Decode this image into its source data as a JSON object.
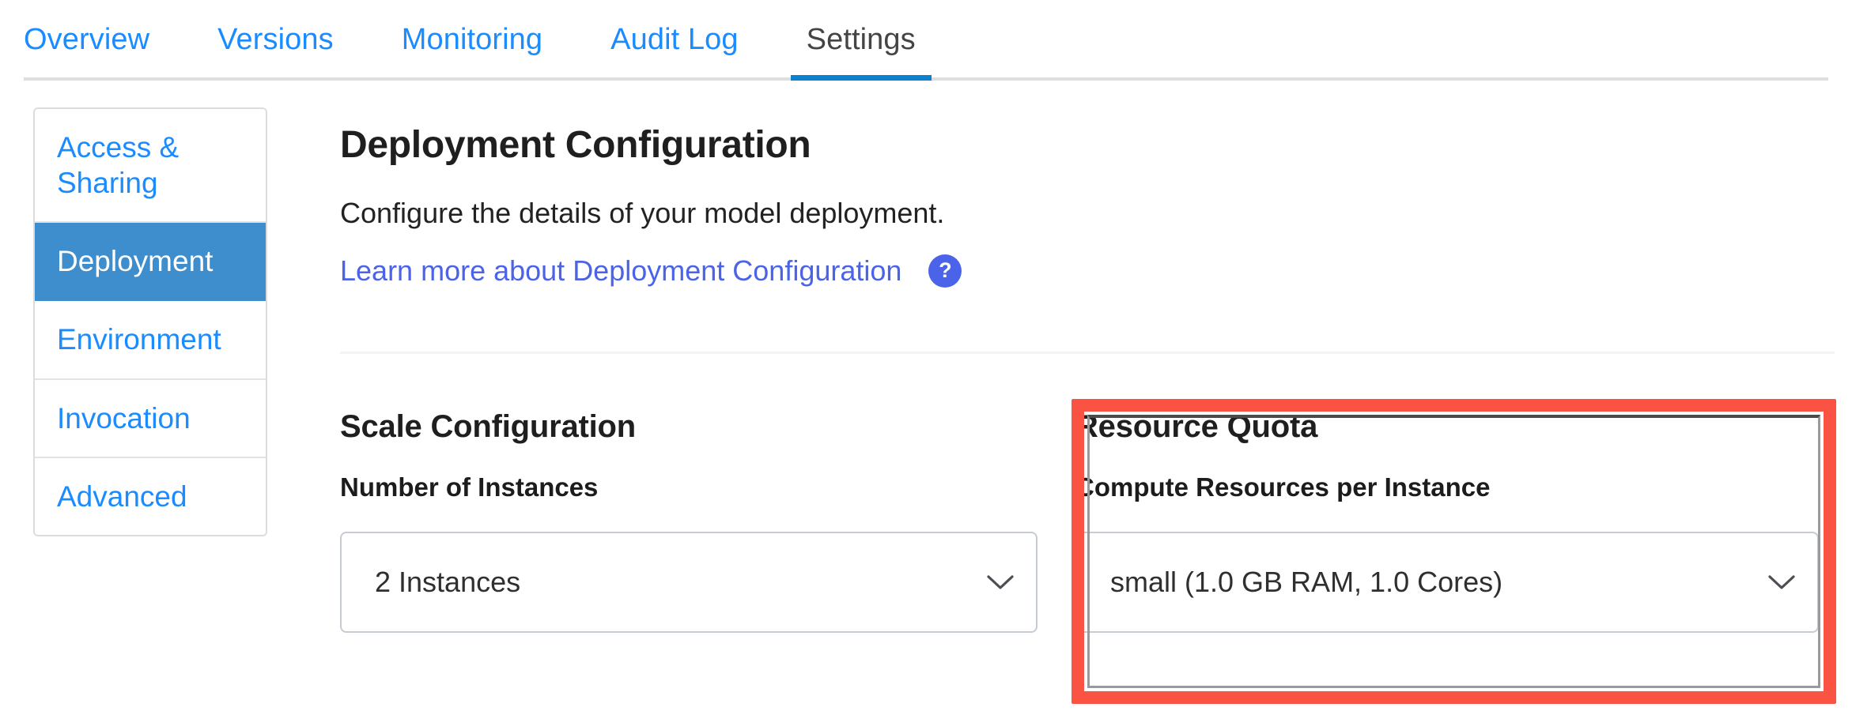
{
  "tabs": {
    "items": [
      {
        "label": "Overview",
        "active": false
      },
      {
        "label": "Versions",
        "active": false
      },
      {
        "label": "Monitoring",
        "active": false
      },
      {
        "label": "Audit Log",
        "active": false
      },
      {
        "label": "Settings",
        "active": true
      }
    ]
  },
  "sidebar": {
    "items": [
      {
        "label": "Access & Sharing",
        "active": false
      },
      {
        "label": "Deployment",
        "active": true
      },
      {
        "label": "Environment",
        "active": false
      },
      {
        "label": "Invocation",
        "active": false
      },
      {
        "label": "Advanced",
        "active": false
      }
    ]
  },
  "main": {
    "title": "Deployment Configuration",
    "description": "Configure the details of your model deployment.",
    "learn_more_label": "Learn more about Deployment Configuration",
    "help_icon_glyph": "?",
    "help_icon_name": "question-mark-icon"
  },
  "scale_configuration": {
    "section_title": "Scale Configuration",
    "field_label": "Number of Instances",
    "selected_value": "2 Instances"
  },
  "resource_quota": {
    "section_title": "Resource Quota",
    "field_label": "Compute Resources per Instance",
    "selected_value": "small (1.0 GB RAM, 1.0 Cores)"
  },
  "colors": {
    "tab_link_blue": "#1a8cff",
    "tab_active_text": "#444444",
    "tab_active_underline": "#0b82d0",
    "sidebar_link_blue": "#1a8cff",
    "sidebar_active_bg": "#3e8dcc",
    "learn_more_blue": "#4a63e8",
    "highlight_red": "#fa5343",
    "select_border": "#c6ccd2"
  }
}
